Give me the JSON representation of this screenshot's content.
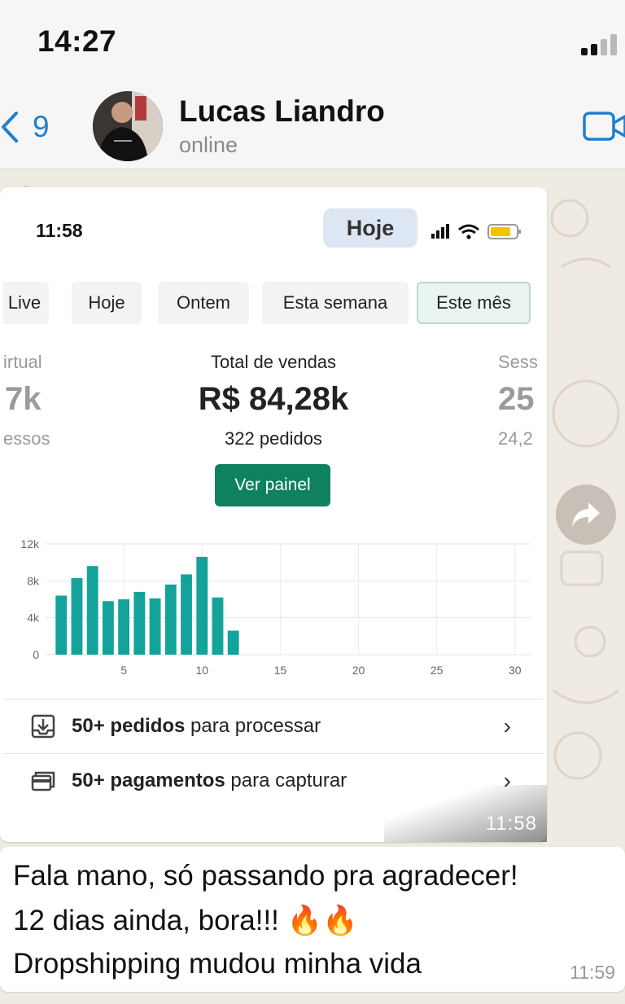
{
  "status_bar": {
    "time": "14:27"
  },
  "header": {
    "back_count": "9",
    "contact_name": "Lucas Liandro",
    "contact_status": "online"
  },
  "image_message": {
    "screenshot": {
      "time": "11:58",
      "date_chip": "Hoje",
      "tabs": [
        "Live",
        "Hoje",
        "Ontem",
        "Esta semana",
        "Este mês"
      ],
      "active_tab": "Este mês",
      "left_partial": {
        "title": "irtual",
        "value": "7k",
        "sub": "essos"
      },
      "right_partial": {
        "title": "Sess",
        "value": "25",
        "sub": "24,2"
      },
      "total": {
        "title": "Total de vendas",
        "value": "R$ 84,28k",
        "sub": "322 pedidos"
      },
      "panel_button": "Ver painel",
      "rows": [
        {
          "bold": "50+ pedidos",
          "rest": " para processar"
        },
        {
          "bold": "50+ pagamentos",
          "rest": " para capturar"
        }
      ]
    },
    "time": "11:58"
  },
  "chart_data": {
    "type": "bar",
    "x": [
      1,
      2,
      3,
      4,
      5,
      6,
      7,
      8,
      9,
      10,
      11,
      12
    ],
    "values": [
      6400,
      8300,
      9600,
      5800,
      6000,
      6800,
      6100,
      7600,
      8700,
      10600,
      6200,
      2600
    ],
    "xticks": [
      "5",
      "10",
      "15",
      "20",
      "25",
      "30"
    ],
    "yticks": [
      "0",
      "4k",
      "8k",
      "12k"
    ],
    "xlim": [
      0,
      31
    ],
    "ylim": [
      0,
      12000
    ],
    "grid": true,
    "bar_color": "#13a39a"
  },
  "text_message": {
    "lines": [
      "Fala mano, só passando pra agradecer!",
      "12 dias ainda, bora!!! 🔥🔥",
      "Dropshipping mudou minha vida"
    ],
    "time": "11:59"
  }
}
